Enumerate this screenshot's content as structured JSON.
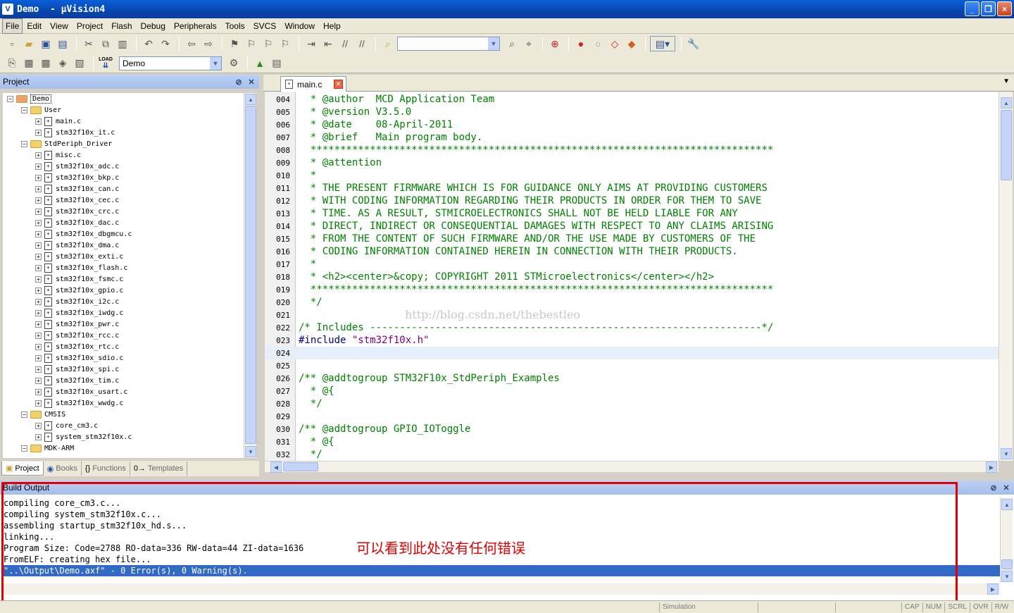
{
  "window": {
    "title": "Demo  - µVision4",
    "controls": [
      "_",
      "❐",
      "×"
    ]
  },
  "menu": [
    "File",
    "Edit",
    "View",
    "Project",
    "Flash",
    "Debug",
    "Peripherals",
    "Tools",
    "SVCS",
    "Window",
    "Help"
  ],
  "toolbar2": {
    "target": "Demo",
    "load_label": "LOAD"
  },
  "project_panel": {
    "title": "Project",
    "tree": [
      {
        "level": 0,
        "type": "root",
        "label": "Demo",
        "expanded": true
      },
      {
        "level": 1,
        "type": "folder",
        "label": "User",
        "expanded": true
      },
      {
        "level": 2,
        "type": "file",
        "label": "main.c"
      },
      {
        "level": 2,
        "type": "file",
        "label": "stm32f10x_it.c"
      },
      {
        "level": 1,
        "type": "folder",
        "label": "StdPeriph_Driver",
        "expanded": true
      },
      {
        "level": 2,
        "type": "file",
        "label": "misc.c"
      },
      {
        "level": 2,
        "type": "file",
        "label": "stm32f10x_adc.c"
      },
      {
        "level": 2,
        "type": "file",
        "label": "stm32f10x_bkp.c"
      },
      {
        "level": 2,
        "type": "file",
        "label": "stm32f10x_can.c"
      },
      {
        "level": 2,
        "type": "file",
        "label": "stm32f10x_cec.c"
      },
      {
        "level": 2,
        "type": "file",
        "label": "stm32f10x_crc.c"
      },
      {
        "level": 2,
        "type": "file",
        "label": "stm32f10x_dac.c"
      },
      {
        "level": 2,
        "type": "file",
        "label": "stm32f10x_dbgmcu.c"
      },
      {
        "level": 2,
        "type": "file",
        "label": "stm32f10x_dma.c"
      },
      {
        "level": 2,
        "type": "file",
        "label": "stm32f10x_exti.c"
      },
      {
        "level": 2,
        "type": "file",
        "label": "stm32f10x_flash.c"
      },
      {
        "level": 2,
        "type": "file",
        "label": "stm32f10x_fsmc.c"
      },
      {
        "level": 2,
        "type": "file",
        "label": "stm32f10x_gpio.c"
      },
      {
        "level": 2,
        "type": "file",
        "label": "stm32f10x_i2c.c"
      },
      {
        "level": 2,
        "type": "file",
        "label": "stm32f10x_iwdg.c"
      },
      {
        "level": 2,
        "type": "file",
        "label": "stm32f10x_pwr.c"
      },
      {
        "level": 2,
        "type": "file",
        "label": "stm32f10x_rcc.c"
      },
      {
        "level": 2,
        "type": "file",
        "label": "stm32f10x_rtc.c"
      },
      {
        "level": 2,
        "type": "file",
        "label": "stm32f10x_sdio.c"
      },
      {
        "level": 2,
        "type": "file",
        "label": "stm32f10x_spi.c"
      },
      {
        "level": 2,
        "type": "file",
        "label": "stm32f10x_tim.c"
      },
      {
        "level": 2,
        "type": "file",
        "label": "stm32f10x_usart.c"
      },
      {
        "level": 2,
        "type": "file",
        "label": "stm32f10x_wwdg.c"
      },
      {
        "level": 1,
        "type": "folder",
        "label": "CMSIS",
        "expanded": true
      },
      {
        "level": 2,
        "type": "file",
        "label": "core_cm3.c"
      },
      {
        "level": 2,
        "type": "file",
        "label": "system_stm32f10x.c"
      },
      {
        "level": 1,
        "type": "folder",
        "label": "MDK-ARM",
        "expanded": true
      }
    ],
    "tabs": [
      {
        "label": "Project",
        "icon": "project-icon",
        "active": true
      },
      {
        "label": "Books",
        "icon": "books-icon",
        "active": false
      },
      {
        "label": "Functions",
        "icon": "{}",
        "active": false
      },
      {
        "label": "Templates",
        "icon": "0→",
        "active": false
      }
    ]
  },
  "editor": {
    "tab_label": "main.c",
    "highlight_line": "024",
    "lines": [
      {
        "n": "004",
        "t": "  * @author  MCD Application Team",
        "k": "comment"
      },
      {
        "n": "005",
        "t": "  * @version V3.5.0",
        "k": "comment"
      },
      {
        "n": "006",
        "t": "  * @date    08-April-2011",
        "k": "comment"
      },
      {
        "n": "007",
        "t": "  * @brief   Main program body.",
        "k": "comment"
      },
      {
        "n": "008",
        "t": "  ******************************************************************************",
        "k": "comment"
      },
      {
        "n": "009",
        "t": "  * @attention",
        "k": "comment"
      },
      {
        "n": "010",
        "t": "  *",
        "k": "comment"
      },
      {
        "n": "011",
        "t": "  * THE PRESENT FIRMWARE WHICH IS FOR GUIDANCE ONLY AIMS AT PROVIDING CUSTOMERS",
        "k": "comment"
      },
      {
        "n": "012",
        "t": "  * WITH CODING INFORMATION REGARDING THEIR PRODUCTS IN ORDER FOR THEM TO SAVE",
        "k": "comment"
      },
      {
        "n": "013",
        "t": "  * TIME. AS A RESULT, STMICROELECTRONICS SHALL NOT BE HELD LIABLE FOR ANY",
        "k": "comment"
      },
      {
        "n": "014",
        "t": "  * DIRECT, INDIRECT OR CONSEQUENTIAL DAMAGES WITH RESPECT TO ANY CLAIMS ARISING",
        "k": "comment"
      },
      {
        "n": "015",
        "t": "  * FROM THE CONTENT OF SUCH FIRMWARE AND/OR THE USE MADE BY CUSTOMERS OF THE",
        "k": "comment"
      },
      {
        "n": "016",
        "t": "  * CODING INFORMATION CONTAINED HEREIN IN CONNECTION WITH THEIR PRODUCTS.",
        "k": "comment"
      },
      {
        "n": "017",
        "t": "  *",
        "k": "comment"
      },
      {
        "n": "018",
        "t": "  * <h2><center>&copy; COPYRIGHT 2011 STMicroelectronics</center></h2>",
        "k": "comment"
      },
      {
        "n": "019",
        "t": "  ******************************************************************************",
        "k": "comment"
      },
      {
        "n": "020",
        "t": "  */",
        "k": "comment"
      },
      {
        "n": "021",
        "t": "",
        "k": "plain"
      },
      {
        "n": "022",
        "t": "/* Includes ------------------------------------------------------------------*/",
        "k": "comment"
      },
      {
        "n": "023",
        "t": "#include ",
        "s": "\"stm32f10x.h\"",
        "k": "include"
      },
      {
        "n": "024",
        "t": "",
        "k": "plain"
      },
      {
        "n": "025",
        "t": "",
        "k": "plain"
      },
      {
        "n": "026",
        "t": "/** @addtogroup STM32F10x_StdPeriph_Examples",
        "k": "comment"
      },
      {
        "n": "027",
        "t": "  * @{",
        "k": "comment"
      },
      {
        "n": "028",
        "t": "  */",
        "k": "comment"
      },
      {
        "n": "029",
        "t": "",
        "k": "plain"
      },
      {
        "n": "030",
        "t": "/** @addtogroup GPIO_IOToggle",
        "k": "comment"
      },
      {
        "n": "031",
        "t": "  * @{",
        "k": "comment"
      },
      {
        "n": "032",
        "t": "  */",
        "k": "comment"
      }
    ],
    "watermark": "http://blog.csdn.net/thebestleo"
  },
  "build_output": {
    "title": "Build Output",
    "lines": [
      "compiling core_cm3.c...",
      "compiling system_stm32f10x.c...",
      "assembling startup_stm32f10x_hd.s...",
      "linking...",
      "Program Size: Code=2788 RO-data=336 RW-data=44 ZI-data=1636",
      "FromELF: creating hex file...",
      "\"..\\Output\\Demo.axf\" - 0 Error(s), 0 Warning(s)."
    ],
    "selected_index": 6,
    "annotation": "可以看到此处没有任何错误",
    "annotation_color": "#e00000"
  },
  "status": {
    "simulation": "Simulation",
    "cap": "CAP",
    "num": "NUM",
    "scrl": "SCRL",
    "ovr": "OVR",
    "rw": "R/W"
  }
}
